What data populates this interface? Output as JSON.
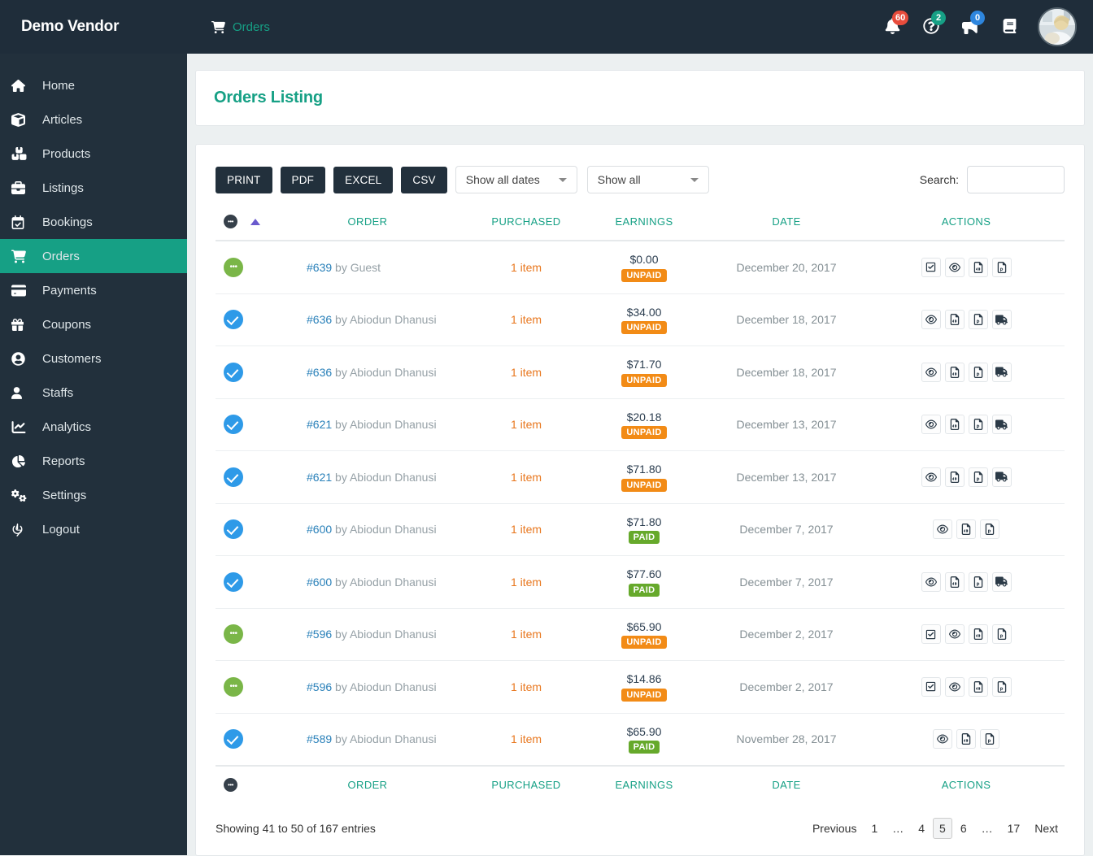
{
  "brand": "Demo Vendor",
  "topnav": [
    {
      "label": "Orders",
      "icon": "cart-icon"
    }
  ],
  "top_icons": [
    {
      "name": "bell-icon",
      "badge": "60",
      "badge_color": "#e74c3c"
    },
    {
      "name": "help-circle-icon",
      "badge": "2",
      "badge_color": "#16a085"
    },
    {
      "name": "megaphone-icon",
      "badge": "0",
      "badge_color": "#2e86de"
    },
    {
      "name": "book-icon",
      "badge": "",
      "badge_color": ""
    }
  ],
  "avatar": {
    "name": "user-avatar"
  },
  "sidebar": {
    "items": [
      {
        "label": "Home",
        "icon": "home-icon",
        "active": false
      },
      {
        "label": "Articles",
        "icon": "cube-icon",
        "active": false
      },
      {
        "label": "Products",
        "icon": "boxes-icon",
        "active": false
      },
      {
        "label": "Listings",
        "icon": "briefcase-icon",
        "active": false
      },
      {
        "label": "Bookings",
        "icon": "calendar-check-icon",
        "active": false
      },
      {
        "label": "Orders",
        "icon": "cart-icon",
        "active": true
      },
      {
        "label": "Payments",
        "icon": "credit-card-icon",
        "active": false
      },
      {
        "label": "Coupons",
        "icon": "gift-icon",
        "active": false
      },
      {
        "label": "Customers",
        "icon": "user-circle-icon",
        "active": false
      },
      {
        "label": "Staffs",
        "icon": "user-icon",
        "active": false
      },
      {
        "label": "Analytics",
        "icon": "line-chart-icon",
        "active": false
      },
      {
        "label": "Reports",
        "icon": "pie-chart-icon",
        "active": false
      },
      {
        "label": "Settings",
        "icon": "gears-icon",
        "active": false
      },
      {
        "label": "Logout",
        "icon": "power-icon",
        "active": false
      }
    ]
  },
  "page": {
    "title": "Orders Listing"
  },
  "toolbar": {
    "export_buttons": [
      "PRINT",
      "PDF",
      "EXCEL",
      "CSV"
    ],
    "date_filter": {
      "value": "Show all dates"
    },
    "status_filter": {
      "value": "Show all"
    },
    "search": {
      "label": "Search:",
      "value": "",
      "placeholder": ""
    }
  },
  "table": {
    "columns": [
      "",
      "ORDER",
      "PURCHASED",
      "EARNINGS",
      "DATE",
      "ACTIONS"
    ],
    "sort_column": 0,
    "sort_direction": "asc",
    "rows": [
      {
        "status": "green",
        "order_id": "#639",
        "by": "by Guest",
        "purchased": "1 item",
        "amount": "$0.00",
        "pay_state": "UNPAID",
        "date": "December 20, 2017",
        "actions": [
          "check-square-icon",
          "eye-icon",
          "file-pdf-icon",
          "file-powerpoint-icon"
        ]
      },
      {
        "status": "blue",
        "order_id": "#636",
        "by": "by Abiodun Dhanusi",
        "purchased": "1 item",
        "amount": "$34.00",
        "pay_state": "UNPAID",
        "date": "December 18, 2017",
        "actions": [
          "eye-icon",
          "file-pdf-icon",
          "file-powerpoint-icon",
          "truck-icon"
        ]
      },
      {
        "status": "blue",
        "order_id": "#636",
        "by": "by Abiodun Dhanusi",
        "purchased": "1 item",
        "amount": "$71.70",
        "pay_state": "UNPAID",
        "date": "December 18, 2017",
        "actions": [
          "eye-icon",
          "file-pdf-icon",
          "file-powerpoint-icon",
          "truck-icon"
        ]
      },
      {
        "status": "blue",
        "order_id": "#621",
        "by": "by Abiodun Dhanusi",
        "purchased": "1 item",
        "amount": "$20.18",
        "pay_state": "UNPAID",
        "date": "December 13, 2017",
        "actions": [
          "eye-icon",
          "file-pdf-icon",
          "file-powerpoint-icon",
          "truck-icon"
        ]
      },
      {
        "status": "blue",
        "order_id": "#621",
        "by": "by Abiodun Dhanusi",
        "purchased": "1 item",
        "amount": "$71.80",
        "pay_state": "UNPAID",
        "date": "December 13, 2017",
        "actions": [
          "eye-icon",
          "file-pdf-icon",
          "file-powerpoint-icon",
          "truck-icon"
        ]
      },
      {
        "status": "blue",
        "order_id": "#600",
        "by": "by Abiodun Dhanusi",
        "purchased": "1 item",
        "amount": "$71.80",
        "pay_state": "PAID",
        "date": "December 7, 2017",
        "actions": [
          "eye-icon",
          "file-pdf-icon",
          "file-powerpoint-icon"
        ]
      },
      {
        "status": "blue",
        "order_id": "#600",
        "by": "by Abiodun Dhanusi",
        "purchased": "1 item",
        "amount": "$77.60",
        "pay_state": "PAID",
        "date": "December 7, 2017",
        "actions": [
          "eye-icon",
          "file-pdf-icon",
          "file-powerpoint-icon",
          "truck-icon"
        ]
      },
      {
        "status": "green",
        "order_id": "#596",
        "by": "by Abiodun Dhanusi",
        "purchased": "1 item",
        "amount": "$65.90",
        "pay_state": "UNPAID",
        "date": "December 2, 2017",
        "actions": [
          "check-square-icon",
          "eye-icon",
          "file-pdf-icon",
          "file-powerpoint-icon"
        ]
      },
      {
        "status": "green",
        "order_id": "#596",
        "by": "by Abiodun Dhanusi",
        "purchased": "1 item",
        "amount": "$14.86",
        "pay_state": "UNPAID",
        "date": "December 2, 2017",
        "actions": [
          "check-square-icon",
          "eye-icon",
          "file-pdf-icon",
          "file-powerpoint-icon"
        ]
      },
      {
        "status": "blue",
        "order_id": "#589",
        "by": "by Abiodun Dhanusi",
        "purchased": "1 item",
        "amount": "$65.90",
        "pay_state": "PAID",
        "date": "November 28, 2017",
        "actions": [
          "eye-icon",
          "file-pdf-icon",
          "file-powerpoint-icon"
        ]
      }
    ]
  },
  "footer": {
    "entries_info": "Showing 41 to 50 of 167 entries",
    "pagination": {
      "previous": "Previous",
      "next": "Next",
      "pages": [
        "1",
        "…",
        "4",
        "5",
        "6",
        "…",
        "17"
      ],
      "current": "5"
    }
  },
  "colors": {
    "accent_teal": "#16a085",
    "sidebar_bg": "#22303c",
    "topbar_bg": "#1f2d3a",
    "unpaid": "#f28b16",
    "paid": "#66a92b",
    "order_link": "#2980b9",
    "item_link": "#e8761d"
  }
}
